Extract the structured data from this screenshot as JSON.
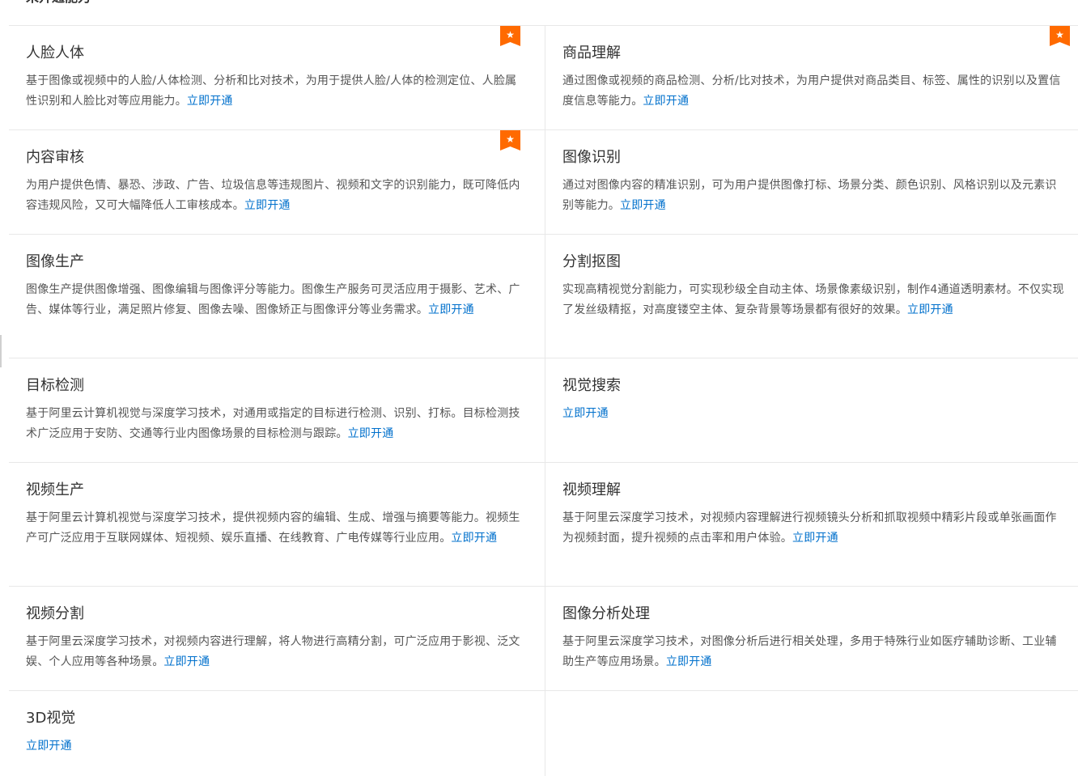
{
  "section": {
    "title": "未开通能力"
  },
  "icon": {
    "badge": "star-icon",
    "glyph": "★",
    "color": "#ff6a00"
  },
  "link_color": "#0070cc",
  "cards": [
    {
      "title": "人脸人体",
      "desc": "基于图像或视频中的人脸/人体检测、分析和比对技术，为用于提供人脸/人体的检测定位、人脸属性识别和人脸比对等应用能力。",
      "link": "立即开通",
      "featured": true
    },
    {
      "title": "商品理解",
      "desc": "通过图像或视频的商品检测、分析/比对技术，为用户提供对商品类目、标签、属性的识别以及置信度信息等能力。",
      "link": "立即开通",
      "featured": true
    },
    {
      "title": "内容审核",
      "desc": "为用户提供色情、暴恐、涉政、广告、垃圾信息等违规图片、视频和文字的识别能力，既可降低内容违规风险，又可大幅降低人工审核成本。",
      "link": "立即开通",
      "featured": true
    },
    {
      "title": "图像识别",
      "desc": "通过对图像内容的精准识别，可为用户提供图像打标、场景分类、颜色识别、风格识别以及元素识别等能力。",
      "link": "立即开通",
      "featured": false
    },
    {
      "title": "图像生产",
      "desc": "图像生产提供图像增强、图像编辑与图像评分等能力。图像生产服务可灵活应用于摄影、艺术、广告、媒体等行业，满足照片修复、图像去噪、图像矫正与图像评分等业务需求。",
      "link": "立即开通",
      "featured": false
    },
    {
      "title": "分割抠图",
      "desc": "实现高精视觉分割能力，可实现秒级全自动主体、场景像素级识别，制作4通道透明素材。不仅实现了发丝级精抠，对高度镂空主体、复杂背景等场景都有很好的效果。",
      "link": "立即开通",
      "featured": false
    },
    {
      "title": "目标检测",
      "desc": "基于阿里云计算机视觉与深度学习技术，对通用或指定的目标进行检测、识别、打标。目标检测技术广泛应用于安防、交通等行业内图像场景的目标检测与跟踪。",
      "link": "立即开通",
      "featured": false
    },
    {
      "title": "视觉搜索",
      "desc": "",
      "link": "立即开通",
      "featured": false
    },
    {
      "title": "视频生产",
      "desc": "基于阿里云计算机视觉与深度学习技术，提供视频内容的编辑、生成、增强与摘要等能力。视频生产可广泛应用于互联网媒体、短视频、娱乐直播、在线教育、广电传媒等行业应用。",
      "link": "立即开通",
      "featured": false
    },
    {
      "title": "视频理解",
      "desc": "基于阿里云深度学习技术，对视频内容理解进行视频镜头分析和抓取视频中精彩片段或单张画面作为视频封面，提升视频的点击率和用户体验。",
      "link": "立即开通",
      "featured": false
    },
    {
      "title": "视频分割",
      "desc": "基于阿里云深度学习技术，对视频内容进行理解，将人物进行高精分割，可广泛应用于影视、泛文娱、个人应用等各种场景。",
      "link": "立即开通",
      "featured": false
    },
    {
      "title": "图像分析处理",
      "desc": "基于阿里云深度学习技术，对图像分析后进行相关处理，多用于特殊行业如医疗辅助诊断、工业辅助生产等应用场景。",
      "link": "立即开通",
      "featured": false
    },
    {
      "title": "3D视觉",
      "desc": "",
      "link": "立即开通",
      "featured": false
    }
  ]
}
